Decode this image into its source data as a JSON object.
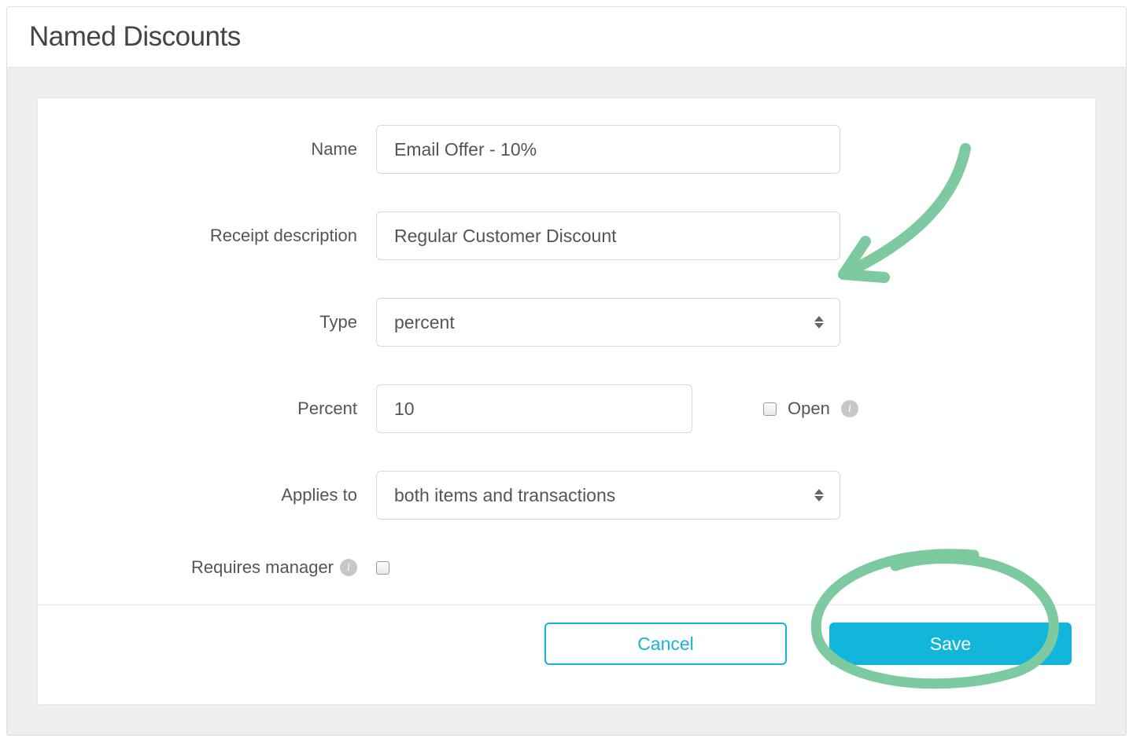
{
  "colors": {
    "accent": "#12b6da",
    "annotation": "#7ecaa0"
  },
  "page": {
    "title": "Named Discounts"
  },
  "form": {
    "name": {
      "label": "Name",
      "value": "Email Offer - 10%"
    },
    "receipt": {
      "label": "Receipt description",
      "value": "Regular Customer Discount"
    },
    "type": {
      "label": "Type",
      "value": "percent"
    },
    "percent": {
      "label": "Percent",
      "value": "10"
    },
    "open": {
      "label": "Open",
      "checked": false
    },
    "applies": {
      "label": "Applies to",
      "value": "both items and transactions"
    },
    "requires_manager": {
      "label": "Requires manager",
      "checked": false
    }
  },
  "buttons": {
    "cancel": "Cancel",
    "save": "Save"
  }
}
